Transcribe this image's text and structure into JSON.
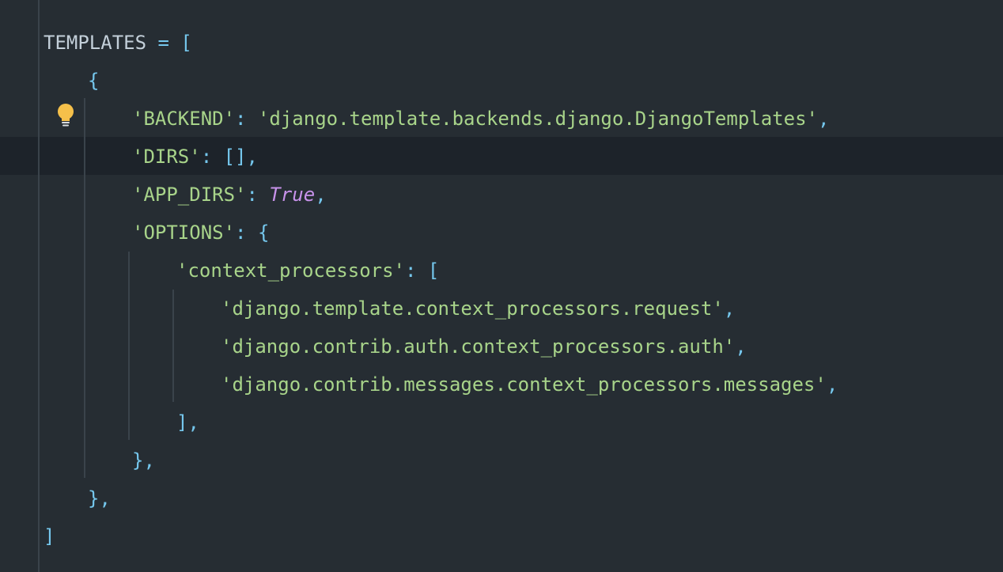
{
  "editor": {
    "lines": [
      {
        "indent": 0,
        "tokens": [
          {
            "t": "TEMPLATES",
            "c": "ident"
          },
          {
            "t": " = ",
            "c": "op"
          },
          {
            "t": "[",
            "c": "brace"
          }
        ]
      },
      {
        "indent": 1,
        "tokens": [
          {
            "t": "{",
            "c": "brace"
          }
        ]
      },
      {
        "indent": 2,
        "tokens": [
          {
            "t": "'BACKEND'",
            "c": "str"
          },
          {
            "t": ": ",
            "c": "op"
          },
          {
            "t": "'django.template.backends.django.DjangoTemplates'",
            "c": "str"
          },
          {
            "t": ",",
            "c": "op"
          }
        ]
      },
      {
        "indent": 2,
        "tokens": [
          {
            "t": "'DIRS'",
            "c": "str"
          },
          {
            "t": ": ",
            "c": "op"
          },
          {
            "t": "[]",
            "c": "brace"
          },
          {
            "t": ",",
            "c": "op"
          }
        ]
      },
      {
        "indent": 2,
        "tokens": [
          {
            "t": "'APP_DIRS'",
            "c": "str"
          },
          {
            "t": ": ",
            "c": "op"
          },
          {
            "t": "True",
            "c": "kw"
          },
          {
            "t": ",",
            "c": "op"
          }
        ]
      },
      {
        "indent": 2,
        "tokens": [
          {
            "t": "'OPTIONS'",
            "c": "str"
          },
          {
            "t": ": ",
            "c": "op"
          },
          {
            "t": "{",
            "c": "brace"
          }
        ]
      },
      {
        "indent": 3,
        "tokens": [
          {
            "t": "'context_processors'",
            "c": "str"
          },
          {
            "t": ": ",
            "c": "op"
          },
          {
            "t": "[",
            "c": "brace"
          }
        ]
      },
      {
        "indent": 4,
        "tokens": [
          {
            "t": "'django.template.context_processors.request'",
            "c": "str"
          },
          {
            "t": ",",
            "c": "op"
          }
        ]
      },
      {
        "indent": 4,
        "tokens": [
          {
            "t": "'django.contrib.auth.context_processors.auth'",
            "c": "str"
          },
          {
            "t": ",",
            "c": "op"
          }
        ]
      },
      {
        "indent": 4,
        "tokens": [
          {
            "t": "'django.contrib.messages.context_processors.messages'",
            "c": "str"
          },
          {
            "t": ",",
            "c": "op"
          }
        ]
      },
      {
        "indent": 3,
        "tokens": [
          {
            "t": "]",
            "c": "brace"
          },
          {
            "t": ",",
            "c": "op"
          }
        ]
      },
      {
        "indent": 2,
        "tokens": [
          {
            "t": "}",
            "c": "brace"
          },
          {
            "t": ",",
            "c": "op"
          }
        ]
      },
      {
        "indent": 1,
        "tokens": [
          {
            "t": "}",
            "c": "brace"
          },
          {
            "t": ",",
            "c": "op"
          }
        ]
      },
      {
        "indent": 0,
        "tokens": [
          {
            "t": "]",
            "c": "brace"
          }
        ]
      }
    ],
    "current_line_index": 3,
    "intention_icon": "lightbulb-icon"
  },
  "colors": {
    "background": "#262d33",
    "current_line": "#1d232a",
    "string": "#a8d48a",
    "brace": "#75c7ed",
    "keyword": "#c792ea",
    "identifier": "#c3cfd9",
    "bulb": "#f5c04a"
  }
}
